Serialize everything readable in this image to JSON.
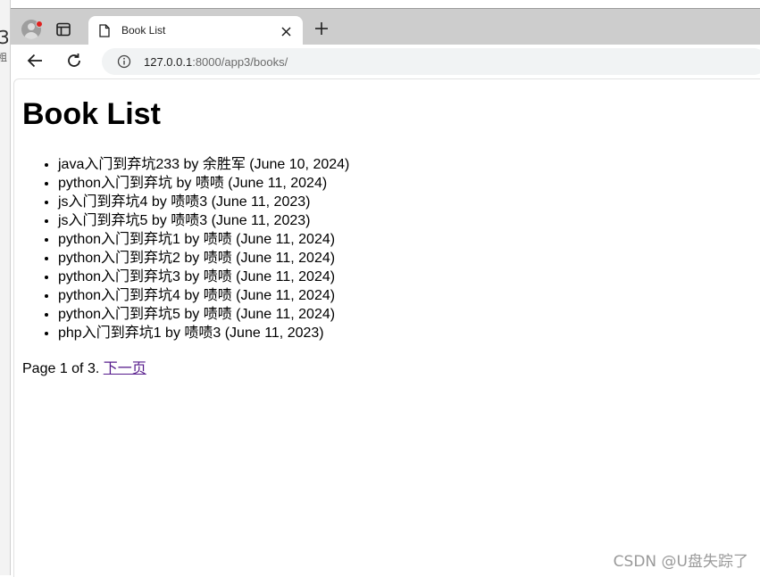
{
  "background_window": {
    "fragment_1": "3",
    "fragment_2": "粗"
  },
  "browser": {
    "tab": {
      "title": "Book List"
    },
    "address_bar": {
      "url_host": "127.0.0.1",
      "url_path": ":8000/app3/books/"
    },
    "icons": {
      "profile": "profile-avatar-icon",
      "tab_actions": "tab-search-icon",
      "favicon": "document-icon",
      "close": "close-icon",
      "new_tab": "plus-icon",
      "back": "back-arrow-icon",
      "reload": "reload-icon",
      "site_info": "info-icon"
    },
    "colors": {
      "tabstrip": "#cdcdcd",
      "notification_dot": "#e0201e",
      "visited_link": "#551a8b"
    }
  },
  "page": {
    "heading": "Book List",
    "books": [
      "java入门到弃坑233 by 余胜军 (June 10, 2024)",
      "python入门到弃坑 by 啧啧 (June 11, 2024)",
      "js入门到弃坑4 by 啧啧3 (June 11, 2023)",
      "js入门到弃坑5 by 啧啧3 (June 11, 2023)",
      "python入门到弃坑1 by 啧啧 (June 11, 2024)",
      "python入门到弃坑2 by 啧啧 (June 11, 2024)",
      "python入门到弃坑3 by 啧啧 (June 11, 2024)",
      "python入门到弃坑4 by 啧啧 (June 11, 2024)",
      "python入门到弃坑5 by 啧啧 (June 11, 2024)",
      "php入门到弃坑1 by 啧啧3 (June 11, 2023)"
    ],
    "pagination": {
      "status": "Page 1 of 3.",
      "next_label": "下一页"
    }
  },
  "watermark": "CSDN @U盘失踪了"
}
